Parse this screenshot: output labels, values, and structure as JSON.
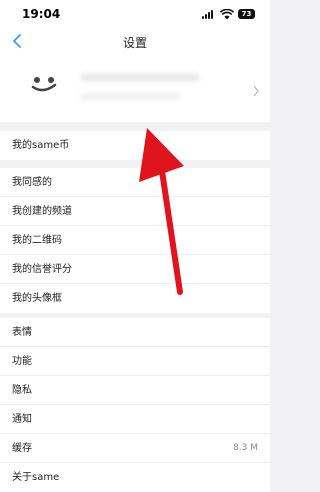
{
  "status": {
    "time": "19:04",
    "battery": "73"
  },
  "nav": {
    "title": "设置"
  },
  "sections": [
    {
      "items": [
        {
          "label": "我的same币"
        }
      ]
    },
    {
      "items": [
        {
          "label": "我同感的"
        },
        {
          "label": "我创建的频道"
        },
        {
          "label": "我的二维码"
        },
        {
          "label": "我的信誉评分"
        },
        {
          "label": "我的头像框"
        }
      ]
    },
    {
      "items": [
        {
          "label": "表情"
        },
        {
          "label": "功能"
        },
        {
          "label": "隐私"
        },
        {
          "label": "通知"
        },
        {
          "label": "缓存",
          "value": "8.3 M"
        },
        {
          "label": "关于same"
        }
      ]
    }
  ],
  "annotation": {
    "arrow_color": "#e0141e"
  }
}
